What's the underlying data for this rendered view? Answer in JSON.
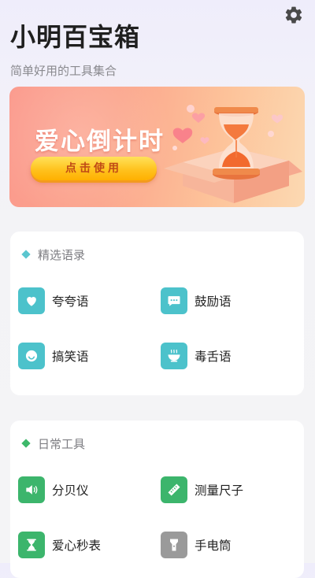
{
  "header": {
    "title": "小明百宝箱",
    "subtitle": "简单好用的工具集合"
  },
  "settings": {
    "icon": "gear-icon",
    "color": "#4a4a4a"
  },
  "banner": {
    "title": "爱心倒计时",
    "button_label": "点击使用",
    "illustration": "hourglass-hearts"
  },
  "sections": [
    {
      "title": "精选语录",
      "accent": "#5bc6cf",
      "items": [
        {
          "label": "夸夸语",
          "icon": "heart-icon",
          "color": "#4cc2cb"
        },
        {
          "label": "鼓励语",
          "icon": "chat-bubble-icon",
          "color": "#4cc2cb"
        },
        {
          "label": "搞笑语",
          "icon": "smiley-icon",
          "color": "#4cc2cb"
        },
        {
          "label": "毒舌语",
          "icon": "hot-bowl-icon",
          "color": "#4cc2cb"
        }
      ]
    },
    {
      "title": "日常工具",
      "accent": "#3db86a",
      "items": [
        {
          "label": "分贝仪",
          "icon": "speaker-icon",
          "color": "#3cb56c"
        },
        {
          "label": "测量尺子",
          "icon": "ruler-icon",
          "color": "#3cb56c"
        },
        {
          "label": "爱心秒表",
          "icon": "hourglass-icon",
          "color": "#3cb56c"
        },
        {
          "label": "手电筒",
          "icon": "flashlight-icon",
          "color": "#9a9a9a"
        }
      ]
    }
  ]
}
